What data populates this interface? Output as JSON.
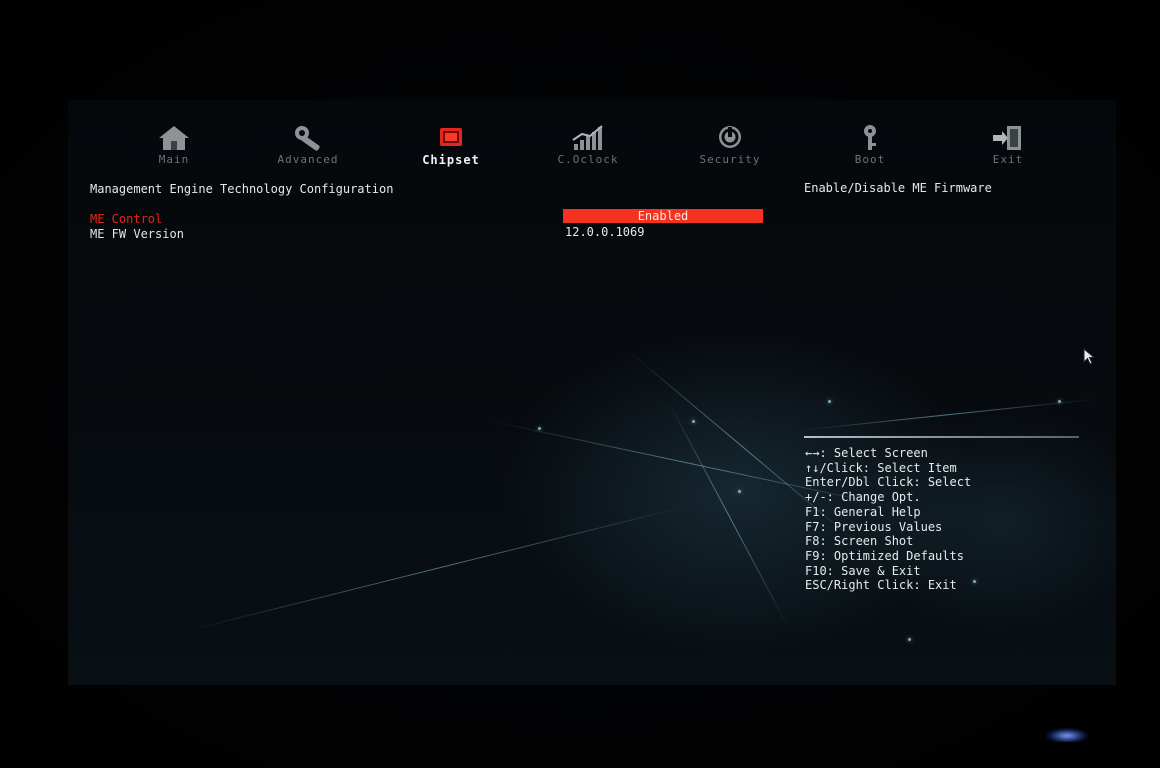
{
  "nav": {
    "items": [
      {
        "label": "Main",
        "icon": "house-icon"
      },
      {
        "label": "Advanced",
        "icon": "wrench-icon"
      },
      {
        "label": "Chipset",
        "icon": "chip-icon",
        "active": true
      },
      {
        "label": "C.Oclock",
        "icon": "signal-bars-icon"
      },
      {
        "label": "Security",
        "icon": "power-shield-icon"
      },
      {
        "label": "Boot",
        "icon": "key-icon"
      },
      {
        "label": "Exit",
        "icon": "exit-door-icon"
      }
    ]
  },
  "page": {
    "title": "Management Engine Technology Configuration",
    "help_text": "Enable/Disable ME Firmware"
  },
  "options": [
    {
      "label": "ME Control",
      "value": "Enabled",
      "selected": true
    },
    {
      "label": "ME FW Version",
      "value": "12.0.0.1069"
    }
  ],
  "keys": [
    "←→: Select Screen",
    "↑↓/Click: Select Item",
    "Enter/Dbl Click: Select",
    "+/-: Change Opt.",
    "F1: General Help",
    "F7: Previous Values",
    "F8: Screen Shot",
    "F9: Optimized Defaults",
    "F10: Save & Exit",
    "ESC/Right Click: Exit"
  ],
  "colors": {
    "accent": "#f4321f",
    "active_label": "#e8261e",
    "text": "#e6e9ec",
    "inactive_tab": "#6d7277"
  }
}
